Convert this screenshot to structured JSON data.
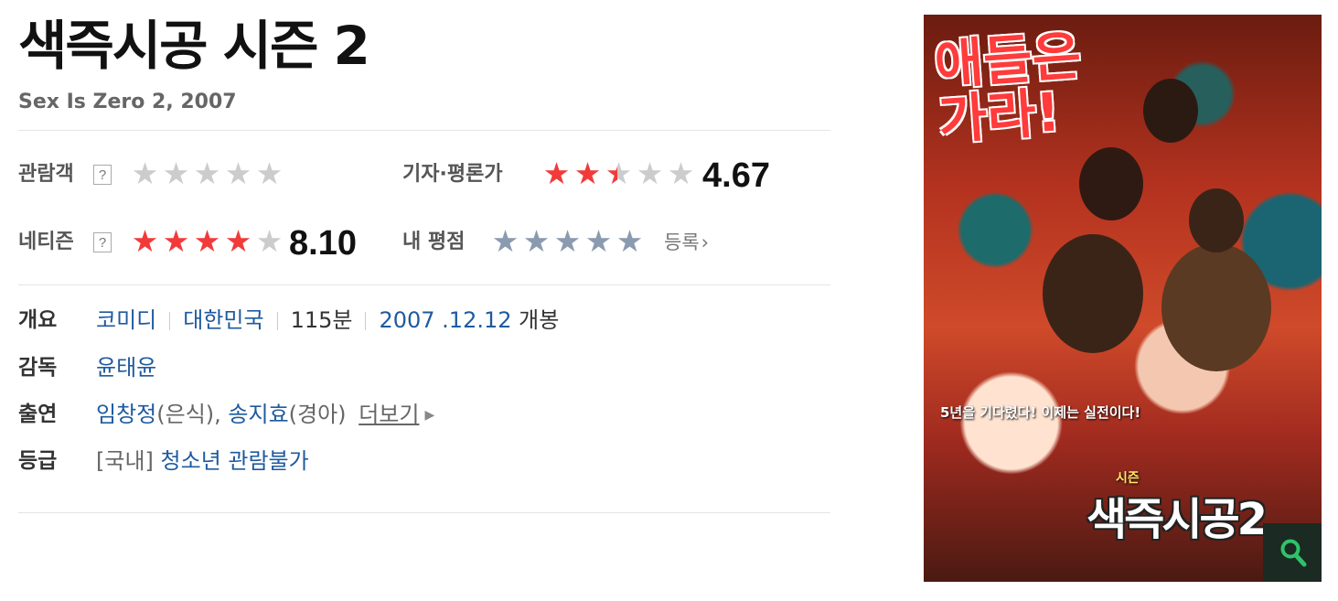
{
  "movie": {
    "title": "색즉시공 시즌 2",
    "original": "Sex Is Zero 2, 2007"
  },
  "ratings": {
    "audience": {
      "label": "관람객",
      "help": "?",
      "stars_filled": 0,
      "score": ""
    },
    "critics": {
      "label": "기자·평론가",
      "stars_filled": 2.5,
      "score": "4.67"
    },
    "netizen": {
      "label": "네티즌",
      "help": "?",
      "stars_filled": 4,
      "score": "8.10"
    },
    "mine": {
      "label": "내 평점",
      "stars_filled": 0,
      "register": "등록",
      "register_arrow": "›"
    }
  },
  "info": {
    "overview_label": "개요",
    "genre": "코미디",
    "country": "대한민국",
    "runtime": "115분",
    "release_date": "2007 .12.12",
    "release_suffix": "개봉",
    "director_label": "감독",
    "director": "윤태윤",
    "cast_label": "출연",
    "actor1": "임창정",
    "actor1_role": "(은식),",
    "actor2": "송지효",
    "actor2_role": "(경아)",
    "more": "더보기",
    "grade_label": "등급",
    "grade_region": "[국내]",
    "grade": "청소년 관람불가"
  },
  "poster": {
    "tagline": "애들은\n가라!",
    "caption": "5년을 기다렸다! 이제는 실전이다!",
    "small_title": "시즌",
    "title": "색즉시공2"
  },
  "colors": {
    "star_red": "#f23a3a",
    "star_grey": "#cccccc",
    "star_slate": "#8a9bb0",
    "link_blue": "#1f5a9f"
  }
}
